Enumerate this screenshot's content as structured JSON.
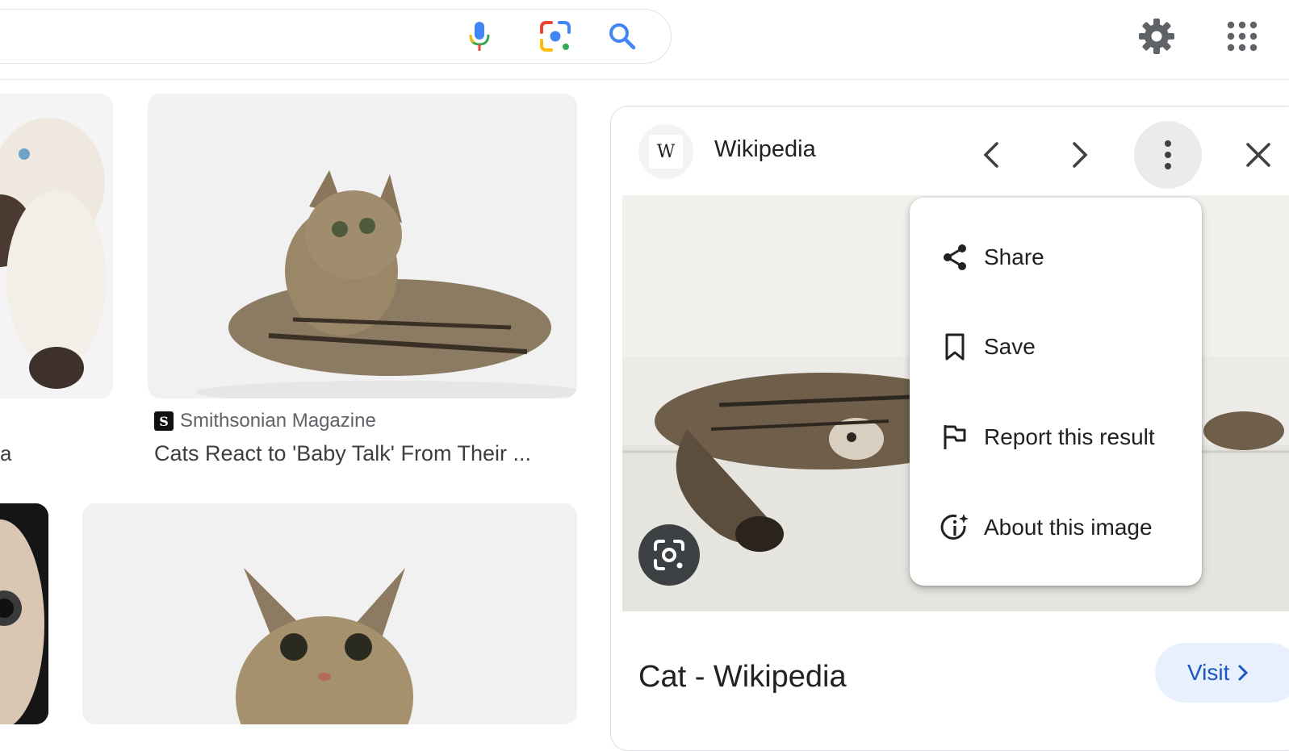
{
  "header": {
    "icons": [
      "mic-icon",
      "lens-icon",
      "search-icon",
      "gear-icon",
      "apps-grid-icon"
    ]
  },
  "grid": {
    "truncated_caption": "a",
    "result": {
      "source_favicon": "S",
      "source": "Smithsonian Magazine",
      "title": "Cats React to 'Baby Talk' From Their ..."
    }
  },
  "panel": {
    "favicon": "W",
    "site_name": "Wikipedia",
    "title": "Cat - Wikipedia",
    "visit_label": "Visit",
    "icons": [
      "chevron-left-icon",
      "chevron-right-icon",
      "more-vert-icon",
      "close-icon",
      "lens-icon"
    ]
  },
  "menu": {
    "items": [
      {
        "label": "Share",
        "icon": "share-icon"
      },
      {
        "label": "Save",
        "icon": "bookmark-icon"
      },
      {
        "label": "Report this result",
        "icon": "flag-icon"
      },
      {
        "label": "About this image",
        "icon": "info-sparkle-icon"
      }
    ]
  },
  "colors": {
    "accent_blue": "#4285f4",
    "red": "#ea4335",
    "yellow": "#fbbc04",
    "green": "#34a853",
    "visit_bg": "#e8f0fe",
    "visit_text": "#1a56c4"
  }
}
